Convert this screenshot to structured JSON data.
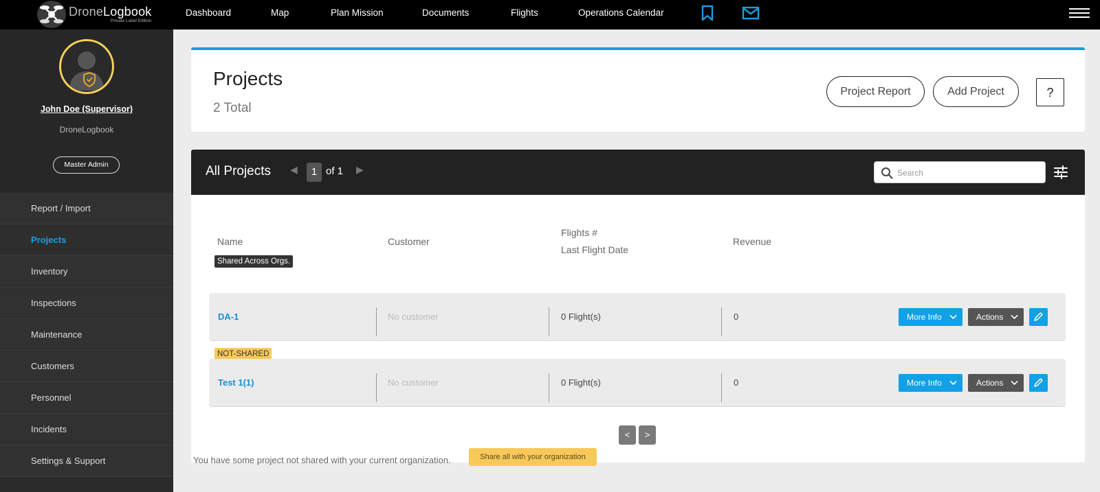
{
  "app": {
    "logo_title_part1": "Drone",
    "logo_title_part2": "Logbook",
    "logo_subtitle": "Private Label Edition"
  },
  "topnav": {
    "items": [
      "Dashboard",
      "Map",
      "Plan Mission",
      "Documents",
      "Flights",
      "Operations Calendar"
    ],
    "icons": [
      "bookmark-icon",
      "mail-icon",
      "hamburger-menu-icon"
    ],
    "accent": "#1b9ce0"
  },
  "sidebar": {
    "user_name": "John Doe (Supervisor)",
    "org_name": "DroneLogbook",
    "role": "Master Admin",
    "items": [
      {
        "label": "Report / Import",
        "active": false
      },
      {
        "label": "Projects",
        "active": true
      },
      {
        "label": "Inventory",
        "active": false
      },
      {
        "label": "Inspections",
        "active": false
      },
      {
        "label": "Maintenance",
        "active": false
      },
      {
        "label": "Customers",
        "active": false
      },
      {
        "label": "Personnel",
        "active": false
      },
      {
        "label": "Incidents",
        "active": false
      },
      {
        "label": "Settings & Support",
        "active": false
      }
    ]
  },
  "header": {
    "title": "Projects",
    "total": "2 Total",
    "project_report": "Project Report",
    "add_project": "Add Project",
    "help": "?"
  },
  "list": {
    "title": "All Projects",
    "page_current": "1",
    "page_of": "of 1",
    "search_placeholder": "Search",
    "columns": {
      "name": "Name",
      "customer": "Customer",
      "flights": "Flights #",
      "last_flight": "Last Flight Date",
      "revenue": "Revenue"
    },
    "rows": [
      {
        "badge": "Shared Across Orgs.",
        "badge_style": "dark",
        "name": "DA-1",
        "customer": "No customer",
        "flights": "0 Flight(s)",
        "revenue": "0",
        "more_info": "More Info",
        "actions": "Actions"
      },
      {
        "badge": "NOT-SHARED",
        "badge_style": "yellow",
        "name": "Test 1(1)",
        "customer": "No customer",
        "flights": "0 Flight(s)",
        "revenue": "0",
        "more_info": "More Info",
        "actions": "Actions"
      }
    ],
    "prev": "<",
    "next": ">",
    "notice": "You have some project not shared with your current organization.",
    "share_button": "Share all with your organization"
  }
}
